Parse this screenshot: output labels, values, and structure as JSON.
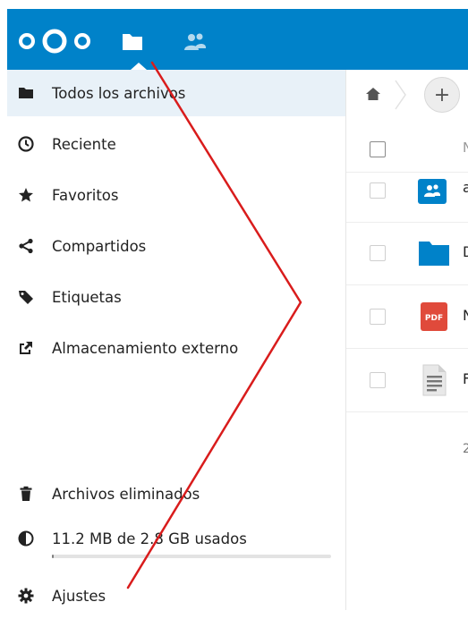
{
  "header": {
    "logo_icon": "nextcloud-logo-icon",
    "apps": [
      {
        "name": "files-app-icon",
        "active": true
      },
      {
        "name": "contacts-app-icon",
        "active": false
      }
    ]
  },
  "sidebar": {
    "items": [
      {
        "label": "Todos los archivos",
        "icon": "folder-icon",
        "active": true
      },
      {
        "label": "Reciente",
        "icon": "clock-icon"
      },
      {
        "label": "Favoritos",
        "icon": "star-icon"
      },
      {
        "label": "Compartidos",
        "icon": "share-icon"
      },
      {
        "label": "Etiquetas",
        "icon": "tag-icon"
      },
      {
        "label": "Almacenamiento externo",
        "icon": "external-storage-icon"
      }
    ],
    "trash_label": "Archivos eliminados",
    "quota_label": "11.2 MB de 2.8 GB usados",
    "quota_fraction": 0.004,
    "settings_label": "Ajustes"
  },
  "main": {
    "breadcrumb_home_icon": "home-icon",
    "new_button_label": "+",
    "column_header": "N",
    "rows": [
      {
        "name": "a",
        "icon": "shared-folder-icon"
      },
      {
        "name": "D",
        "icon": "folder-icon"
      },
      {
        "name": "N",
        "icon": "pdf-icon",
        "icon_text": "PDF"
      },
      {
        "name": "F",
        "icon": "text-document-icon"
      }
    ],
    "summary": "2"
  },
  "colors": {
    "brand": "#0082c9",
    "annotation": "#d91c1c"
  }
}
